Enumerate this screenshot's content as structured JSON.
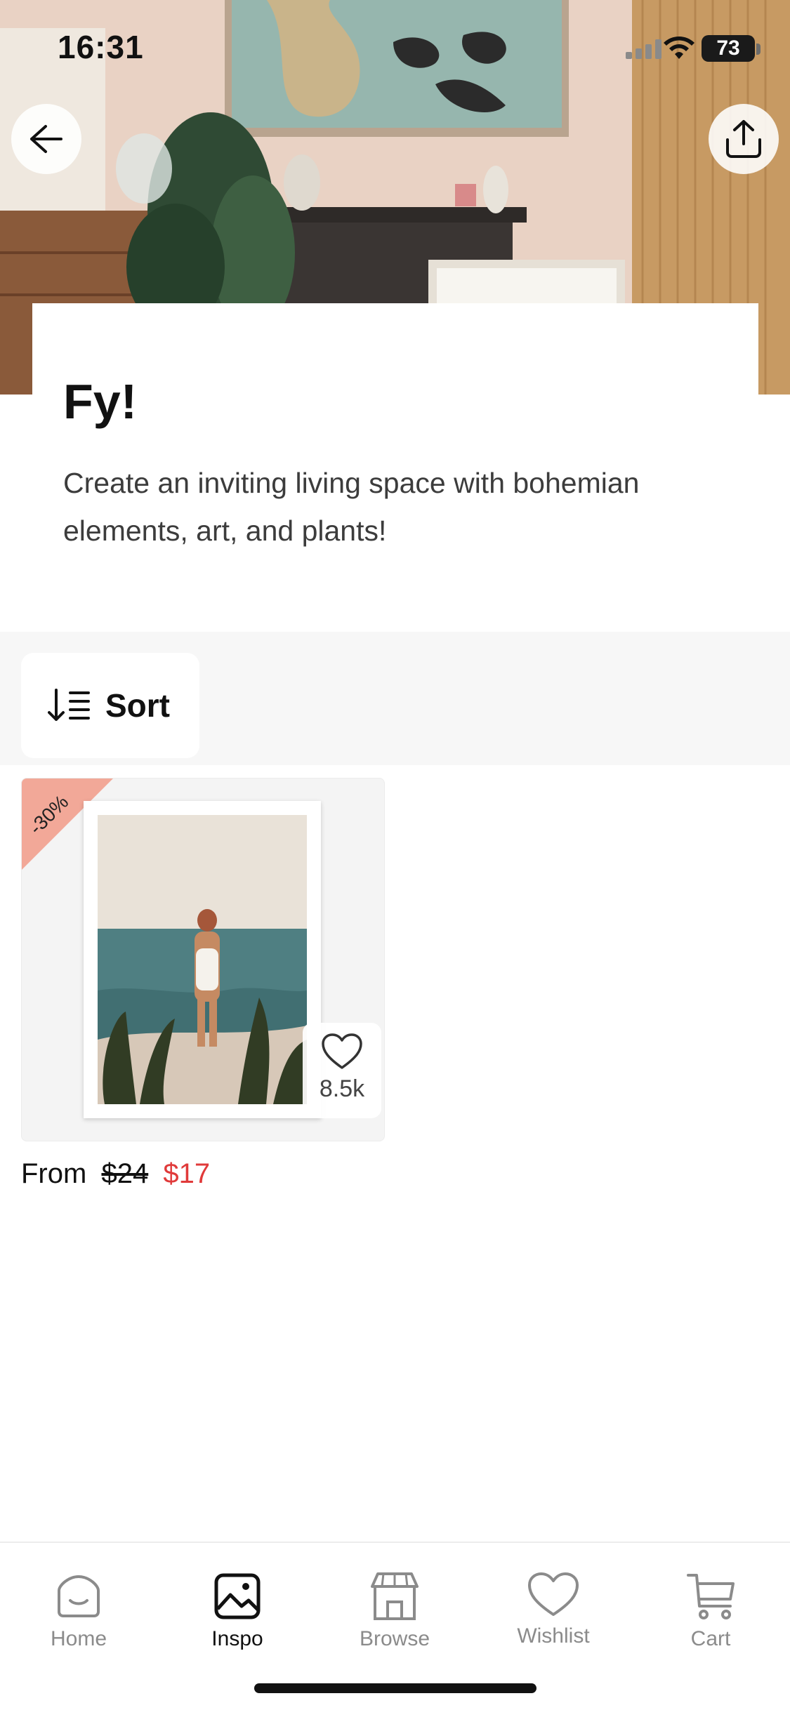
{
  "status_bar": {
    "time": "16:31",
    "battery": "73"
  },
  "hero": {
    "back_icon": "arrow-left-icon",
    "share_icon": "share-upload-icon"
  },
  "intro": {
    "title": "Fy!",
    "description": "Create an inviting living space with bohemian elements, art, and plants!"
  },
  "sort": {
    "label": "Sort",
    "icon": "sort-descending-icon"
  },
  "products": [
    {
      "badge": "-30%",
      "likes": "8.5k",
      "price_prefix": "From",
      "price_old": "$24",
      "price_new": "$17"
    }
  ],
  "tabs": [
    {
      "label": "Home",
      "icon": "home-icon",
      "active": false
    },
    {
      "label": "Inspo",
      "icon": "image-icon",
      "active": true
    },
    {
      "label": "Browse",
      "icon": "store-icon",
      "active": false
    },
    {
      "label": "Wishlist",
      "icon": "heart-icon",
      "active": false
    },
    {
      "label": "Cart",
      "icon": "cart-icon",
      "active": false
    }
  ],
  "colors": {
    "discount": "#f2a898",
    "sale_price": "#e03a3a",
    "tab_inactive": "#8b8b8b"
  }
}
